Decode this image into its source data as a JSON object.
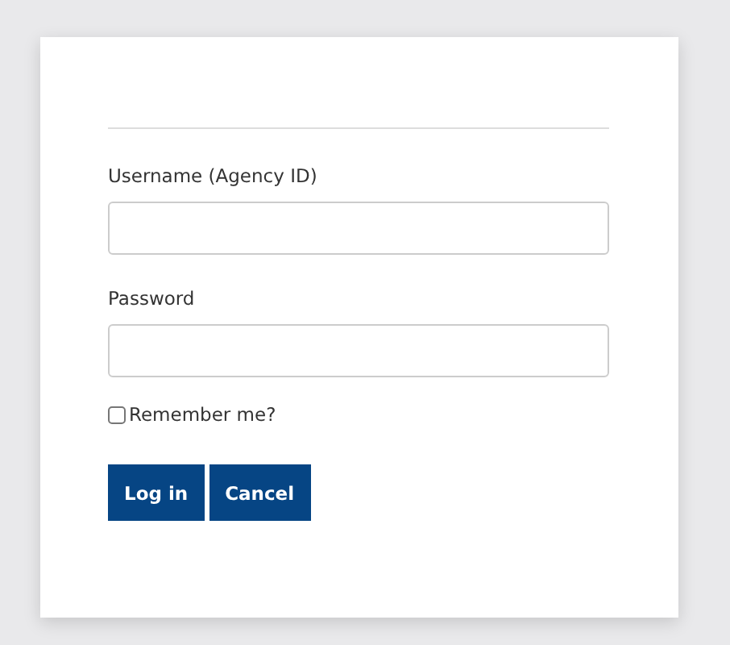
{
  "form": {
    "username": {
      "label": "Username (Agency ID)"
    },
    "password": {
      "label": "Password"
    },
    "remember": {
      "label": "Remember me?",
      "checked": false
    },
    "buttons": [
      {
        "label": "Log in"
      },
      {
        "label": "Cancel"
      }
    ]
  }
}
